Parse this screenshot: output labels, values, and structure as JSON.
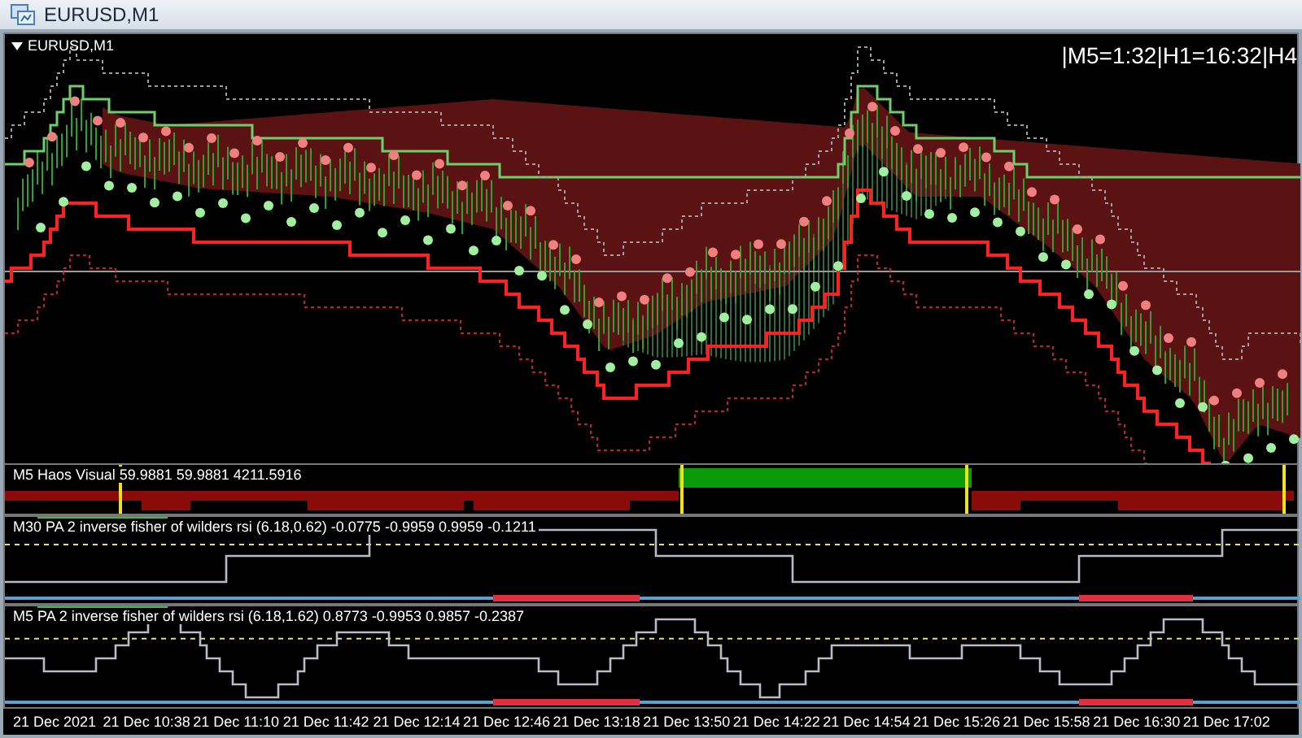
{
  "window": {
    "title": "EURUSD,M1"
  },
  "chart": {
    "symbol_label": "EURUSD,M1",
    "timer_text": "|M5=1:32|H1=16:32|H4"
  },
  "indicators": [
    {
      "kind": "histogram",
      "label": "M5 Haos Visual 59.9881 59.9881 4211.5916"
    },
    {
      "kind": "line",
      "label": "M30 PA 2 inverse fisher of wilders rsi (6.18,0.62) -0.0775 -0.9959 0.9959 -0.1211"
    },
    {
      "kind": "line",
      "label": "M5 PA 2 inverse fisher of wilders rsi (6.18,1.62) 0.8773 -0.9953 0.9857 -0.2387"
    }
  ],
  "time_axis": [
    "21 Dec 2021",
    "21 Dec 10:38",
    "21 Dec 11:10",
    "21 Dec 11:42",
    "21 Dec 12:14",
    "21 Dec 12:46",
    "21 Dec 13:18",
    "21 Dec 13:50",
    "21 Dec 14:22",
    "21 Dec 14:54",
    "21 Dec 15:26",
    "21 Dec 15:58",
    "21 Dec 16:30",
    "21 Dec 17:02"
  ]
}
